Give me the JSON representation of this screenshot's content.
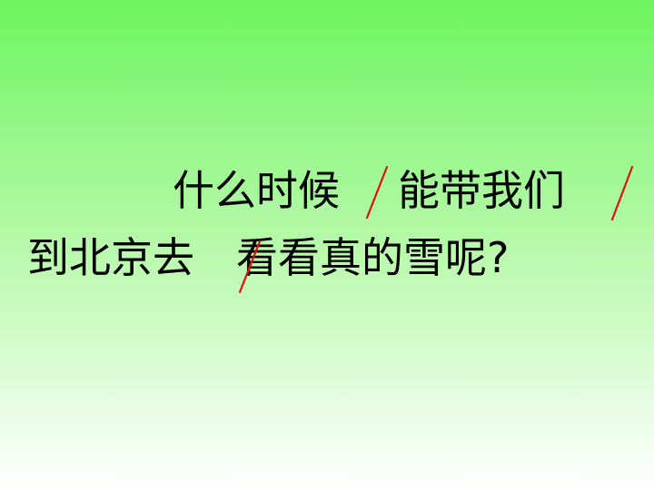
{
  "slide": {
    "line1": {
      "part1": "什么时候",
      "part2": "能带我们"
    },
    "line2": {
      "part1": "到北京去",
      "part2": "看看真的雪呢?"
    }
  },
  "colors": {
    "background_top": "#6cf55f",
    "background_bottom": "#ffffff",
    "text": "#000000",
    "pause_mark": "#e01010"
  },
  "icons": {
    "pause_mark": "red-slash-pause-mark-icon"
  }
}
